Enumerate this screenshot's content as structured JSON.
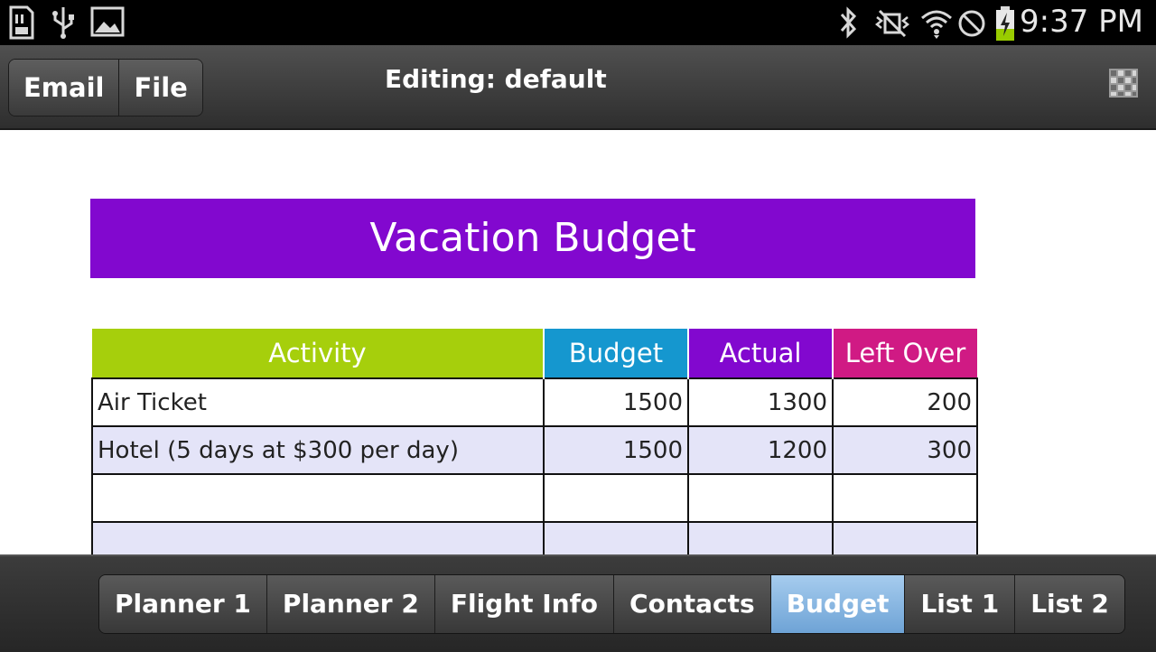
{
  "status_bar": {
    "time": "9:37 PM",
    "left_icons": [
      "sd-card-icon",
      "usb-icon",
      "image-icon"
    ],
    "right_icons": [
      "bluetooth-icon",
      "vibrate-icon",
      "wifi-icon",
      "no-signal-icon",
      "battery-charging-icon"
    ]
  },
  "action_bar": {
    "buttons": [
      {
        "label": "Email"
      },
      {
        "label": "File"
      }
    ],
    "title": "Editing: default",
    "menu_icon": "grid-icon"
  },
  "document": {
    "title": "Vacation Budget",
    "title_color": "#8208cf",
    "columns": [
      {
        "label": "Activity",
        "color": "#a6cf0c"
      },
      {
        "label": "Budget",
        "color": "#1597cf"
      },
      {
        "label": "Actual",
        "color": "#8208cf"
      },
      {
        "label": "Left Over",
        "color": "#d01a84"
      }
    ],
    "rows": [
      [
        "Air Ticket",
        "1500",
        "1300",
        "200"
      ],
      [
        "Hotel (5 days at $300 per day)",
        "1500",
        "1200",
        "300"
      ],
      [
        "",
        "",
        "",
        ""
      ],
      [
        "",
        "",
        "",
        ""
      ],
      [
        "",
        "",
        "",
        ""
      ]
    ],
    "alt_row_color": "#e4e4f8"
  },
  "tab_bar": {
    "tabs": [
      {
        "label": "Planner 1"
      },
      {
        "label": "Planner 2"
      },
      {
        "label": "Flight Info"
      },
      {
        "label": "Contacts"
      },
      {
        "label": "Budget"
      },
      {
        "label": "List 1"
      },
      {
        "label": "List 2"
      }
    ],
    "active": "Budget",
    "active_color": "#7fb0df"
  }
}
